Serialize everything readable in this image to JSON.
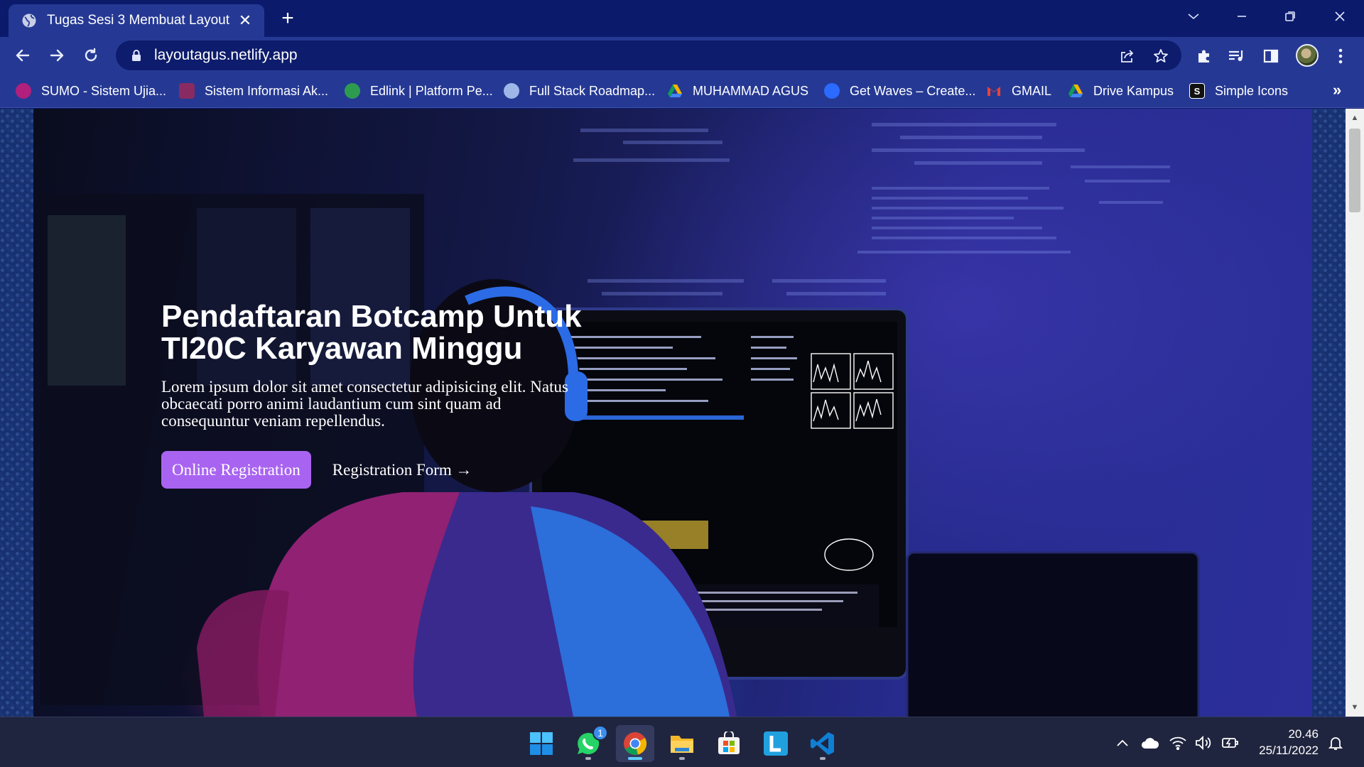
{
  "browser": {
    "tab_title": "Tugas Sesi 3 Membuat Layout",
    "close_tab_glyph": "✕",
    "new_tab_glyph": "+",
    "url": "layoutagus.netlify.app",
    "accent": "#253994",
    "frame_color": "#0b1a6b"
  },
  "bookmarks": [
    {
      "label": "SUMO - Sistem Ujia...",
      "icon": "sumo-icon",
      "color": "#b0207c"
    },
    {
      "label": "Sistem Informasi Ak...",
      "icon": "siakad-icon",
      "color": "#8a2a62"
    },
    {
      "label": "Edlink | Platform Pe...",
      "icon": "edlink-icon",
      "color": "#2e9c4f"
    },
    {
      "label": "Full Stack Roadmap...",
      "icon": "roadmap-icon",
      "color": "#9fb6e8"
    },
    {
      "label": "MUHAMMAD AGUS",
      "icon": "google-drive-icon",
      "color": "#f4b400"
    },
    {
      "label": "Get Waves – Create...",
      "icon": "waves-icon",
      "color": "#2b6bff"
    },
    {
      "label": "GMAIL",
      "icon": "gmail-icon",
      "color": "#ea4335"
    },
    {
      "label": "Drive Kampus",
      "icon": "google-drive-icon",
      "color": "#f4b400"
    },
    {
      "label": "Simple Icons",
      "icon": "simple-icons-icon",
      "color": "#111111"
    }
  ],
  "bookmarks_more": "»",
  "hero": {
    "title": "Pendaftaran Botcamp Untuk TI20C Karyawan Minggu",
    "text": "Lorem ipsum dolor sit amet consectetur adipisicing elit. Natus obcaecati porro animi laudantium cum sint quam ad consequuntur veniam repellendus.",
    "primary_button": "Online Registration",
    "secondary_link": "Registration Form →",
    "button_color": "#a864f0"
  },
  "taskbar": {
    "apps": [
      "windows-start-icon",
      "whatsapp-icon",
      "chrome-icon",
      "file-explorer-icon",
      "microsoft-store-icon",
      "l-app-icon",
      "vscode-icon"
    ],
    "whatsapp_badge": "1",
    "time": "20.46",
    "date": "25/11/2022"
  }
}
